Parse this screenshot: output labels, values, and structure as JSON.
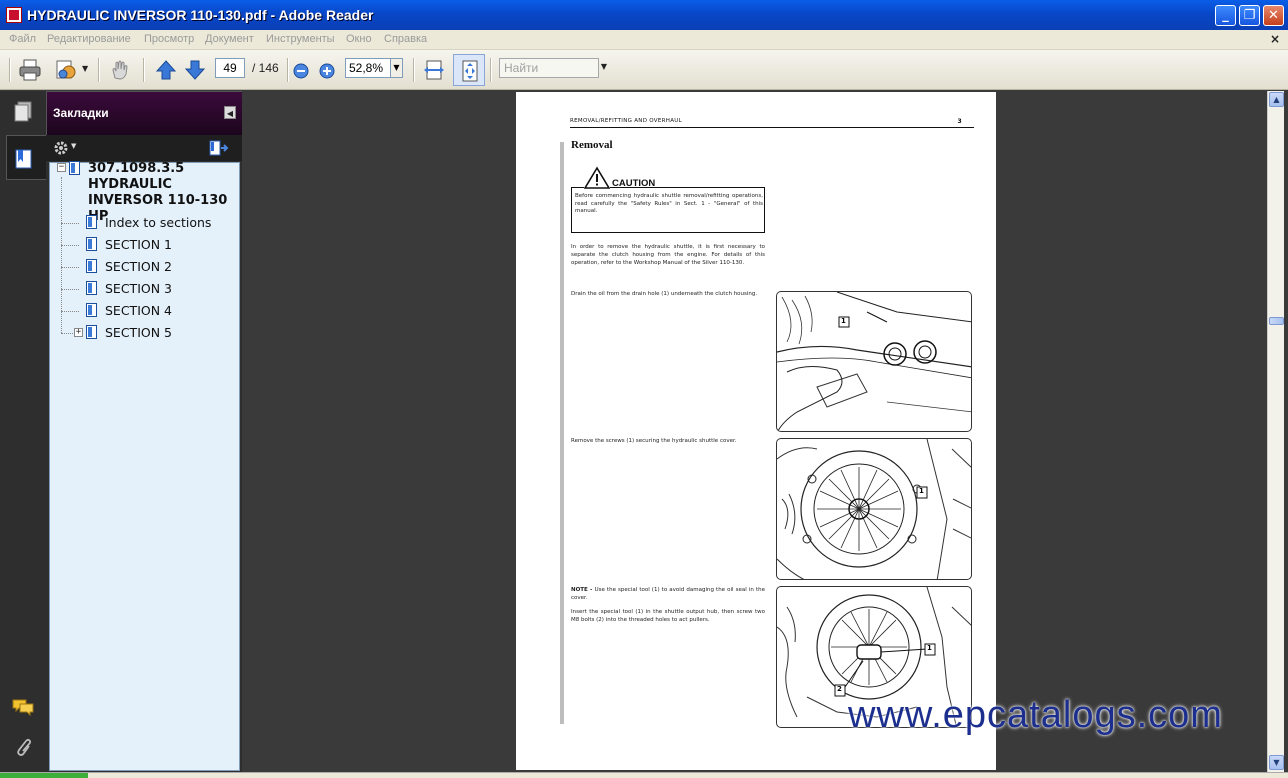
{
  "window": {
    "title": "HYDRAULIC INVERSOR 110-130.pdf - Adobe Reader",
    "minimize": "_",
    "maximize": "❐",
    "close": "✕"
  },
  "menu": {
    "items": [
      "Файл",
      "Редактирование",
      "Просмотр",
      "Документ",
      "Инструменты",
      "Окно",
      "Справка"
    ],
    "close_doc": "×"
  },
  "toolbar": {
    "page_current": "49",
    "page_total": "/ 146",
    "zoom": "52,8%",
    "find_placeholder": "Найти"
  },
  "bookmarks": {
    "panel_title": "Закладки",
    "root": "307.1098.3.5 HYDRAULIC INVERSOR 110-130 HP",
    "items": [
      "Index to sections",
      "SECTION 1",
      "SECTION 2",
      "SECTION 3",
      "SECTION 4",
      "SECTION 5"
    ]
  },
  "document": {
    "header": "REMOVAL/REFITTING AND OVERHAUL",
    "page_number": "3",
    "section_title": "Removal",
    "caution_label": "CAUTION",
    "caution_text": "Before commencing hydraulic shuttle removal/refitting operations, read carefully the \"Safety Rules\" in Sect. 1 - \"General\" of this manual.",
    "intro_text": "In order to remove the hydraulic shuttle, it is first necessary to separate the clutch housing from the engine. For details of this operation, refer to the Workshop Manual of the Silver 110-130.",
    "step1": "Drain the oil from the drain hole (1) underneath the clutch housing.",
    "step2": "Remove the screws (1) securing the hydraulic shuttle cover.",
    "note_label": "NOTE - ",
    "note_text": "Use the special tool (1) to avoid damaging the oil seal in the cover.",
    "step3": "Insert the special tool (1) in the shuttle output hub, then screw two M8 bolts (2) into the threaded holes to act pullers.",
    "callout_1": "1",
    "callout_2": "2"
  },
  "watermark": "www.epcatalogs.com"
}
